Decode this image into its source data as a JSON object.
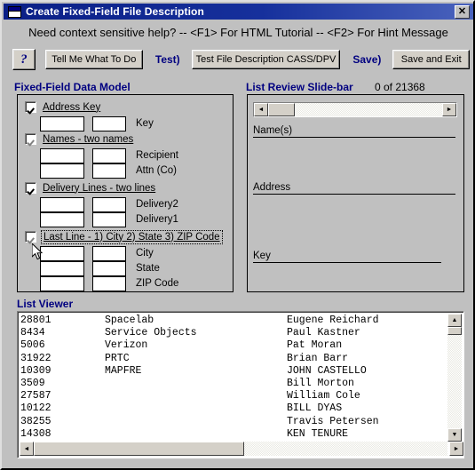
{
  "window": {
    "title": "Create Fixed-Field File Description",
    "close_label": "✕",
    "icon": "window-icon"
  },
  "help_line": {
    "text": "Need context sensitive help?  --  <F1> For HTML Tutorial  --  <F2> For Hint Message"
  },
  "toolbar": {
    "help_icon": "?",
    "tell_me_label": "Tell Me What To Do",
    "test_prefix": "Test)",
    "test_desc_label": "Test File Description CASS/DPV",
    "save_prefix": "Save)",
    "save_exit_label": "Save and Exit"
  },
  "data_model": {
    "title": "Fixed-Field Data Model",
    "groups": [
      {
        "checked": true,
        "check_style": "black",
        "focused": false,
        "label": "Address Key",
        "fields": [
          {
            "label": "Key",
            "start": "",
            "length": ""
          }
        ]
      },
      {
        "checked": true,
        "check_style": "gray",
        "focused": false,
        "label": "Names  -  two names",
        "fields": [
          {
            "label": "Recipient",
            "start": "",
            "length": ""
          },
          {
            "label": "Attn (Co)",
            "start": "",
            "length": ""
          }
        ]
      },
      {
        "checked": true,
        "check_style": "black",
        "focused": false,
        "label": "Delivery Lines  -  two lines",
        "fields": [
          {
            "label": "Delivery2",
            "start": "",
            "length": ""
          },
          {
            "label": "Delivery1",
            "start": "",
            "length": ""
          }
        ]
      },
      {
        "checked": true,
        "check_style": "gray",
        "focused": true,
        "label": "Last Line  -  1) City  2) State  3) ZIP Code",
        "fields": [
          {
            "label": "City",
            "start": "",
            "length": ""
          },
          {
            "label": "State",
            "start": "",
            "length": ""
          },
          {
            "label": "ZIP Code",
            "start": "",
            "length": ""
          }
        ]
      }
    ]
  },
  "slide_bar": {
    "title": "List Review Slide-bar",
    "counter": "0 of 21368",
    "scroll_left_icon": "◄",
    "scroll_right_icon": "►",
    "fields": [
      {
        "label": "Name(s)",
        "value": ""
      },
      {
        "label": "Address",
        "value": ""
      },
      {
        "label": "Key",
        "value": ""
      }
    ]
  },
  "list_viewer": {
    "title": "List Viewer",
    "rows": [
      {
        "key": "28801",
        "company": "Spacelab",
        "name": "Eugene Reichard"
      },
      {
        "key": "8434",
        "company": "Service Objects",
        "name": "Paul Kastner"
      },
      {
        "key": "5006",
        "company": "Verizon",
        "name": "Pat Moran"
      },
      {
        "key": "31922",
        "company": "PRTC",
        "name": "Brian Barr"
      },
      {
        "key": "10309",
        "company": "MAPFRE",
        "name": "JOHN CASTELLO"
      },
      {
        "key": "3509",
        "company": "",
        "name": "Bill Morton"
      },
      {
        "key": "27587",
        "company": "",
        "name": "William Cole"
      },
      {
        "key": "10122",
        "company": "",
        "name": "BILL DYAS"
      },
      {
        "key": "38255",
        "company": "",
        "name": "Travis Petersen"
      },
      {
        "key": "14308",
        "company": "",
        "name": "KEN TENURE"
      }
    ],
    "scroll_up_icon": "▲",
    "scroll_down_icon": "▼",
    "scroll_left_icon": "◄",
    "scroll_right_icon": "►"
  },
  "colors": {
    "title_bar": "#16309c",
    "accent_blue": "#000080",
    "face": "#c0c0c0",
    "button_face": "#d4d0c8"
  }
}
